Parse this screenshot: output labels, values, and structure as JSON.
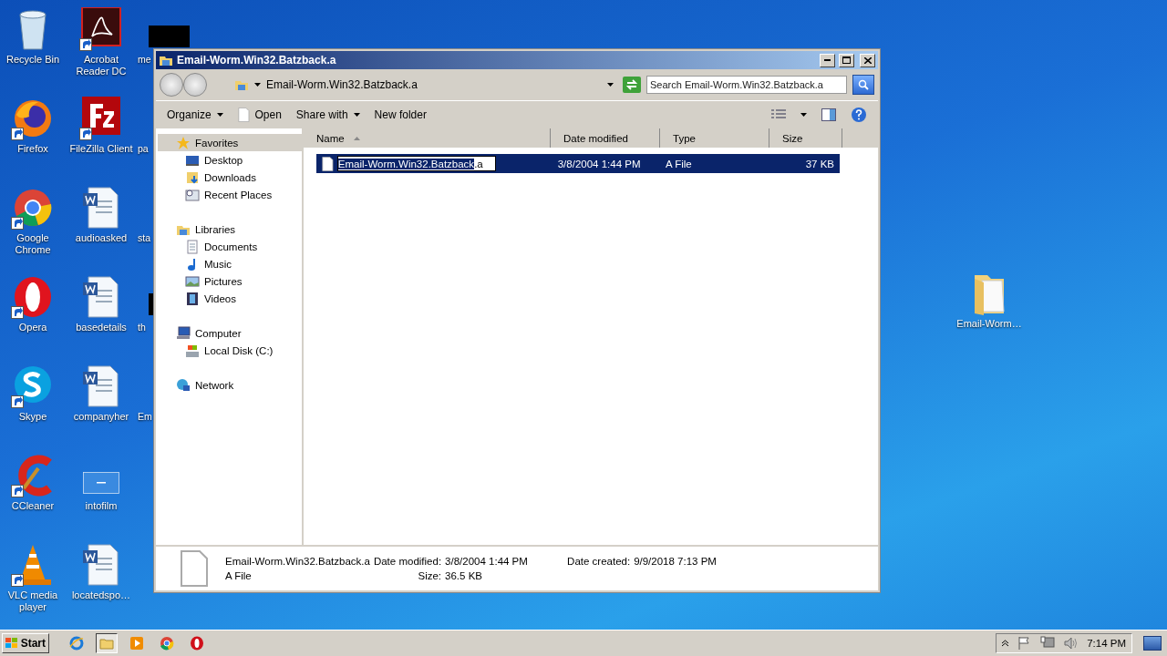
{
  "desktop": {
    "columns": [
      [
        {
          "label": "Recycle Bin",
          "kind": "recycle",
          "shortcut": false
        },
        {
          "label": "Firefox",
          "kind": "firefox",
          "shortcut": true
        },
        {
          "label": "Google Chrome",
          "kind": "chrome",
          "shortcut": true
        },
        {
          "label": "Opera",
          "kind": "opera",
          "shortcut": true
        },
        {
          "label": "Skype",
          "kind": "skype",
          "shortcut": true
        },
        {
          "label": "CCleaner",
          "kind": "ccleaner",
          "shortcut": true
        },
        {
          "label": "VLC media player",
          "kind": "vlc",
          "shortcut": true
        }
      ],
      [
        {
          "label": "Acrobat Reader DC",
          "kind": "acrobat",
          "shortcut": true
        },
        {
          "label": "FileZilla Client",
          "kind": "filezilla",
          "shortcut": true
        },
        {
          "label": "audioasked",
          "kind": "word",
          "shortcut": false
        },
        {
          "label": "basedetails",
          "kind": "word",
          "shortcut": false
        },
        {
          "label": "companyher",
          "kind": "word",
          "shortcut": false
        },
        {
          "label": "intofilm",
          "kind": "blank",
          "shortcut": false
        },
        {
          "label": "locatedspo…",
          "kind": "word",
          "shortcut": false
        }
      ],
      [
        {
          "label": "me",
          "kind": "black"
        },
        {
          "label": "pa",
          "kind": "hidden"
        },
        {
          "label": "sta",
          "kind": "hidden"
        },
        {
          "label": "th",
          "kind": "black"
        },
        {
          "label": "Em",
          "kind": "hidden"
        }
      ]
    ],
    "loose": [
      {
        "label": "Email-Worm…",
        "kind": "folder",
        "shortcut": false
      }
    ]
  },
  "window": {
    "title": "Email-Worm.Win32.Batzback.a",
    "address": "Email-Worm.Win32.Batzback.a",
    "search": {
      "placeholder": "Search Email-Worm.Win32.Batzback.a"
    },
    "toolbar": [
      {
        "label": "Organize",
        "kind": "menu"
      },
      {
        "label": "Open",
        "kind": "open"
      },
      {
        "label": "Share with",
        "kind": "menu"
      },
      {
        "label": "New folder",
        "kind": "plain"
      }
    ],
    "nav": [
      {
        "label": "Favorites",
        "kind": "star",
        "selected": true,
        "children": [
          {
            "label": "Desktop",
            "kind": "desktop",
            "selected": false
          },
          {
            "label": "Downloads",
            "kind": "downloads",
            "selected": false
          },
          {
            "label": "Recent Places",
            "kind": "recent",
            "selected": false
          }
        ]
      },
      {
        "label": "Libraries",
        "kind": "libraries",
        "selected": false,
        "children": [
          {
            "label": "Documents",
            "kind": "documents",
            "selected": false
          },
          {
            "label": "Music",
            "kind": "music",
            "selected": false
          },
          {
            "label": "Pictures",
            "kind": "pictures",
            "selected": false
          },
          {
            "label": "Videos",
            "kind": "videos",
            "selected": false
          }
        ]
      },
      {
        "label": "Computer",
        "kind": "computer",
        "selected": false,
        "children": [
          {
            "label": "Local Disk (C:)",
            "kind": "disk",
            "selected": false
          }
        ]
      },
      {
        "label": "Network",
        "kind": "network",
        "selected": false
      }
    ],
    "columns": [
      {
        "label": "Name",
        "sorted": true
      },
      {
        "label": "Date modified",
        "sorted": false
      },
      {
        "label": "Type",
        "sorted": false
      },
      {
        "label": "Size",
        "sorted": false
      }
    ],
    "rows": [
      {
        "selected": true,
        "editing": true,
        "name_highlighted": "Email-Worm.Win32.Batzback",
        "name_rest": ".a",
        "date": "3/8/2004 1:44 PM",
        "type": "A File",
        "size": "37 KB"
      }
    ],
    "details": {
      "name": "Email-Worm.Win32.Batzback.a",
      "type": "A File",
      "fields": [
        {
          "label": "Date modified:",
          "value": "3/8/2004 1:44 PM"
        },
        {
          "label": "Date created:",
          "value": "9/9/2018 7:13 PM"
        },
        {
          "label": "Size:",
          "value": "36.5 KB"
        }
      ]
    }
  },
  "taskbar": {
    "start": "Start",
    "apps": [
      {
        "kind": "ie",
        "selected": false
      },
      {
        "kind": "explorer",
        "selected": true
      },
      {
        "kind": "media",
        "selected": false
      },
      {
        "kind": "chrome",
        "selected": false
      },
      {
        "kind": "opera",
        "selected": false
      }
    ],
    "clock": "7:14 PM"
  }
}
